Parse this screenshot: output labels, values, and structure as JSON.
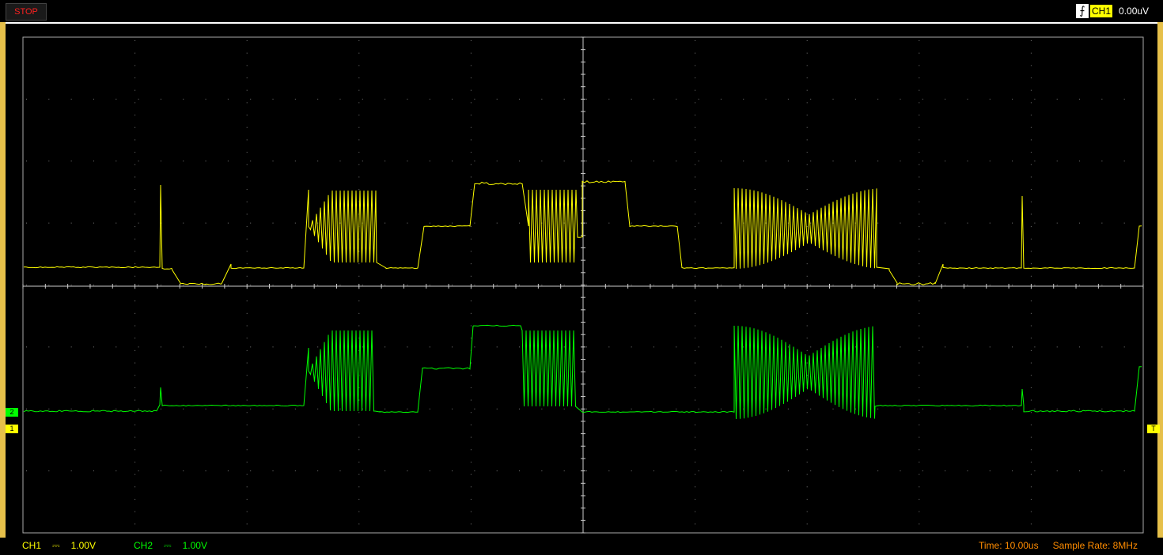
{
  "status": {
    "run_state": "STOP"
  },
  "trigger": {
    "icon": "rising-edge-icon",
    "channel": "CH1",
    "level": "0.00uV"
  },
  "channels": [
    {
      "name": "CH1",
      "coupling": "⎓",
      "scale": "1.00V",
      "color": "#ffff00"
    },
    {
      "name": "CH2",
      "coupling": "⎓",
      "scale": "1.00V",
      "color": "#00ff00"
    }
  ],
  "timebase": {
    "time_label": "Time: 10.00us",
    "sample_rate_label": "Sample Rate: 8MHz"
  },
  "markers": {
    "ch1": "1",
    "ch2": "2",
    "trigger": "T"
  },
  "colors": {
    "ch1": "#ffff00",
    "ch2": "#00ff00",
    "grid": "#888888",
    "accent": "#ff8c00",
    "border": "#e6c04a"
  }
}
